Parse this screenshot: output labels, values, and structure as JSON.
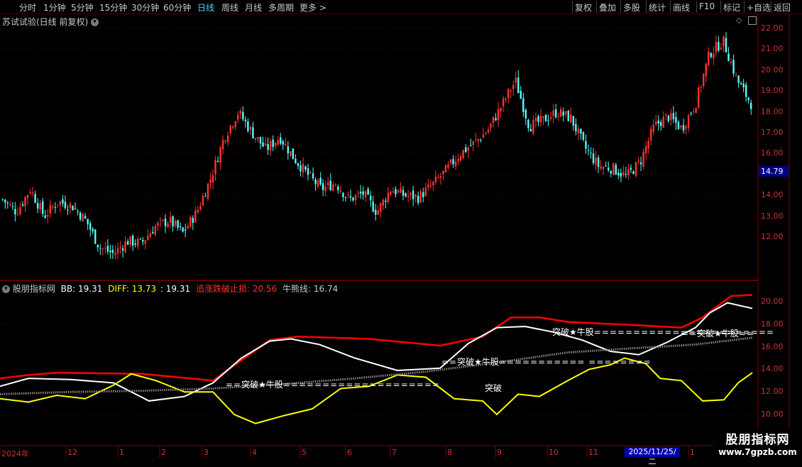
{
  "toolbar": {
    "periods": [
      "分时",
      "1分钟",
      "5分钟",
      "15分钟",
      "30分钟",
      "60分钟",
      "日线",
      "周线",
      "月线",
      "多周期",
      "更多 >"
    ],
    "active_period": "日线",
    "right_buttons": [
      "复权",
      "叠加",
      "多股",
      "统计",
      "画线",
      "F10",
      "标记",
      "+自选",
      "返回"
    ]
  },
  "main_panel": {
    "title": "苏试试验(日线 前复权)",
    "price_ticks": [
      "22.00",
      "21.00",
      "20.00",
      "19.00",
      "18.00",
      "17.00",
      "16.00",
      "14.00",
      "13.00",
      "12.00"
    ],
    "current_price": "14.79"
  },
  "indicator_panel": {
    "name": "股朋指标网",
    "bb_label": "BB:",
    "bb_value": "19.31",
    "diff_label": "DIFF:",
    "diff_value": "13.73",
    "extra_value": ": 19.31",
    "stop_label": "追涨跌破止损:",
    "stop_value": "20.56",
    "bull_label": "牛熊线:",
    "bull_value": "16.74",
    "ticks": [
      "20.00",
      "18.00",
      "16.00",
      "14.00",
      "12.00",
      "10.00"
    ],
    "annotations": {
      "breakout_bull": "突破★牛股",
      "breakout": "突破"
    }
  },
  "x_axis": {
    "labels": [
      "2024年",
      "12",
      "1",
      "2",
      "3",
      "4",
      "5",
      "6",
      "7",
      "8",
      "9",
      "10",
      "11",
      "1"
    ],
    "selected_date": "2025/11/25/二"
  },
  "watermark": {
    "name": "股朋指标网",
    "url": "www.7gpzb.com"
  },
  "colors": {
    "background": "#000000",
    "up_candle": "#ff3232",
    "down_candle": "#54ffff",
    "grid": "#5a0000",
    "bb_line": "#ffffff",
    "diff_line": "#ffff00",
    "stop_line": "#ff0000",
    "bull_line": "#8a8a8a",
    "active_tab": "#4fd0ff",
    "date_highlight": "#0000aa"
  },
  "chart_data": {
    "type": "candlestick",
    "title": "苏试试验(日线 前复权)",
    "ylim": [
      11.0,
      22.3
    ],
    "current_price": 14.79,
    "x_labels": [
      "2024年",
      "12",
      "1",
      "2",
      "3",
      "4",
      "5",
      "6",
      "7",
      "8",
      "9",
      "10",
      "11",
      "1"
    ],
    "approx_close_path": [
      13.8,
      13.2,
      14.3,
      13.0,
      13.7,
      13.5,
      12.8,
      11.5,
      11.2,
      11.8,
      11.7,
      12.5,
      12.8,
      12.2,
      13.2,
      14.8,
      16.8,
      18.0,
      17.0,
      16.2,
      16.8,
      15.8,
      15.0,
      14.3,
      14.6,
      13.8,
      14.1,
      13.2,
      14.3,
      14.0,
      13.9,
      14.5,
      15.2,
      16.0,
      16.5,
      17.1,
      18.3,
      19.5,
      17.3,
      17.6,
      18.0,
      17.7,
      16.3,
      15.4,
      15.3,
      14.9,
      15.6,
      17.3,
      17.8,
      17.2,
      18.4,
      20.8,
      21.4,
      19.5,
      18.4
    ]
  }
}
